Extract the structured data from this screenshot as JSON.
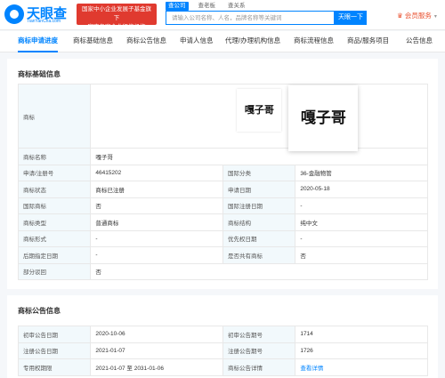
{
  "header": {
    "logo_text": "天眼查",
    "logo_sub": "TianYanCha.com",
    "banner_line1": "国家中小企业发展子基金旗下",
    "banner_line2": "官方备案企业征信机构",
    "search_tabs": [
      "查公司",
      "查老板",
      "查关系"
    ],
    "search_placeholder": "请输入公司名称、人名，品牌名称等关键词",
    "search_button": "天眼一下",
    "vip_label": "会员服务"
  },
  "nav_tabs": [
    "商标申请进度",
    "商标基础信息",
    "商标公告信息",
    "申请人信息",
    "代理/办理机构信息",
    "商标流程信息",
    "商品/服务项目",
    "公告信息"
  ],
  "basic": {
    "title": "商标基础信息",
    "mark_label": "商标",
    "mark_text": "嘎子哥",
    "rows": [
      {
        "l1": "商标名称",
        "v1": "嘎子哥",
        "l2": "",
        "v2": ""
      },
      {
        "l1": "申请/注册号",
        "v1": "46415202",
        "l2": "国际分类",
        "v2": "36-金融物管"
      },
      {
        "l1": "商标状态",
        "v1": "商标已注册",
        "l2": "申请日期",
        "v2": "2020-05-18"
      },
      {
        "l1": "国际商标",
        "v1": "否",
        "l2": "国际注册日期",
        "v2": "-"
      },
      {
        "l1": "商标类型",
        "v1": "普通商标",
        "l2": "商标结构",
        "v2": "纯中文"
      },
      {
        "l1": "商标形式",
        "v1": "-",
        "l2": "优先权日期",
        "v2": "-"
      },
      {
        "l1": "后期指定日期",
        "v1": "-",
        "l2": "是否共有商标",
        "v2": "否"
      },
      {
        "l1": "部分驳回",
        "v1": "否",
        "l2": "",
        "v2": ""
      }
    ]
  },
  "announce": {
    "title": "商标公告信息",
    "rows": [
      {
        "l1": "初审公告日期",
        "v1": "2020-10-06",
        "l2": "初审公告期号",
        "v2": "1714"
      },
      {
        "l1": "注册公告日期",
        "v1": "2021-01-07",
        "l2": "注册公告期号",
        "v2": "1726"
      },
      {
        "l1": "专用权期限",
        "v1": "2021-01-07 至 2031-01-06",
        "l2": "商标公告详情",
        "v2": "查看详情"
      }
    ]
  }
}
